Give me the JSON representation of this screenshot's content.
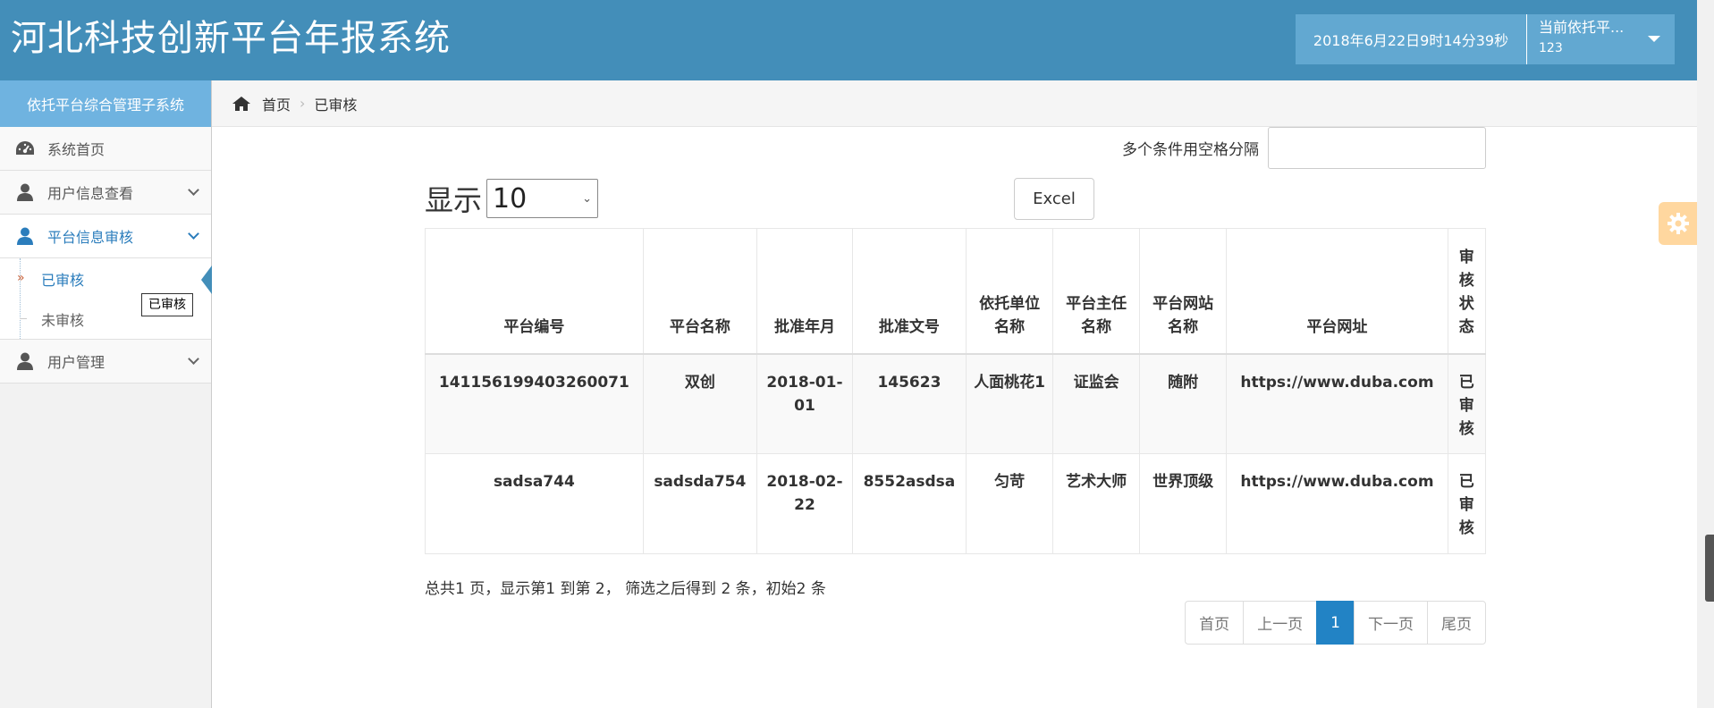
{
  "header": {
    "title": "河北科技创新平台年报系统",
    "datetime": "2018年6月22日9时14分39秒",
    "user_line1": "当前依托平...",
    "user_line2": "123"
  },
  "sidebar": {
    "subsystem_title": "依托平台综合管理子系统",
    "items": [
      {
        "label": "系统首页",
        "icon": "dashboard-icon"
      },
      {
        "label": "用户信息查看",
        "icon": "user-icon"
      },
      {
        "label": "平台信息审核",
        "icon": "user-icon"
      },
      {
        "label": "用户管理",
        "icon": "user-icon"
      }
    ],
    "sub_items": [
      {
        "label": "已审核",
        "tooltip": "已审核"
      },
      {
        "label": "未审核"
      }
    ]
  },
  "breadcrumb": {
    "home": "首页",
    "current": "已审核"
  },
  "filter": {
    "label": "多个条件用空格分隔",
    "value": ""
  },
  "length": {
    "label": "显示",
    "value": "10"
  },
  "excel_label": "Excel",
  "table": {
    "headers": [
      "平台编号",
      "平台名称",
      "批准年月",
      "批准文号",
      "依托单位名称",
      "平台主任名称",
      "平台网站名称",
      "平台网址",
      "审核状态"
    ],
    "rows": [
      [
        "141156199403260071",
        "双创",
        "2018-01-01",
        "145623",
        "人面桃花1",
        "证监会",
        "随附",
        "https://www.duba.com",
        "已审核"
      ],
      [
        "sadsa744",
        "sadsda754",
        "2018-02-22",
        "8552asdsa",
        "匀苛",
        "艺术大师",
        "世界顶级",
        "https://www.duba.com",
        "已审核"
      ]
    ]
  },
  "info_text": "总共1 页，显示第1 到第 2， 筛选之后得到 2 条，初始2 条",
  "pagination": [
    "首页",
    "上一页",
    "1",
    "下一页",
    "尾页"
  ],
  "colors": {
    "header_bg": "#438eb9",
    "header_box": "#62a8d1",
    "subsystem_bg": "#6fb3e0",
    "active_blue": "#2b7dbc",
    "page_active": "#2283c5",
    "settings_btn": "#ffb752"
  }
}
